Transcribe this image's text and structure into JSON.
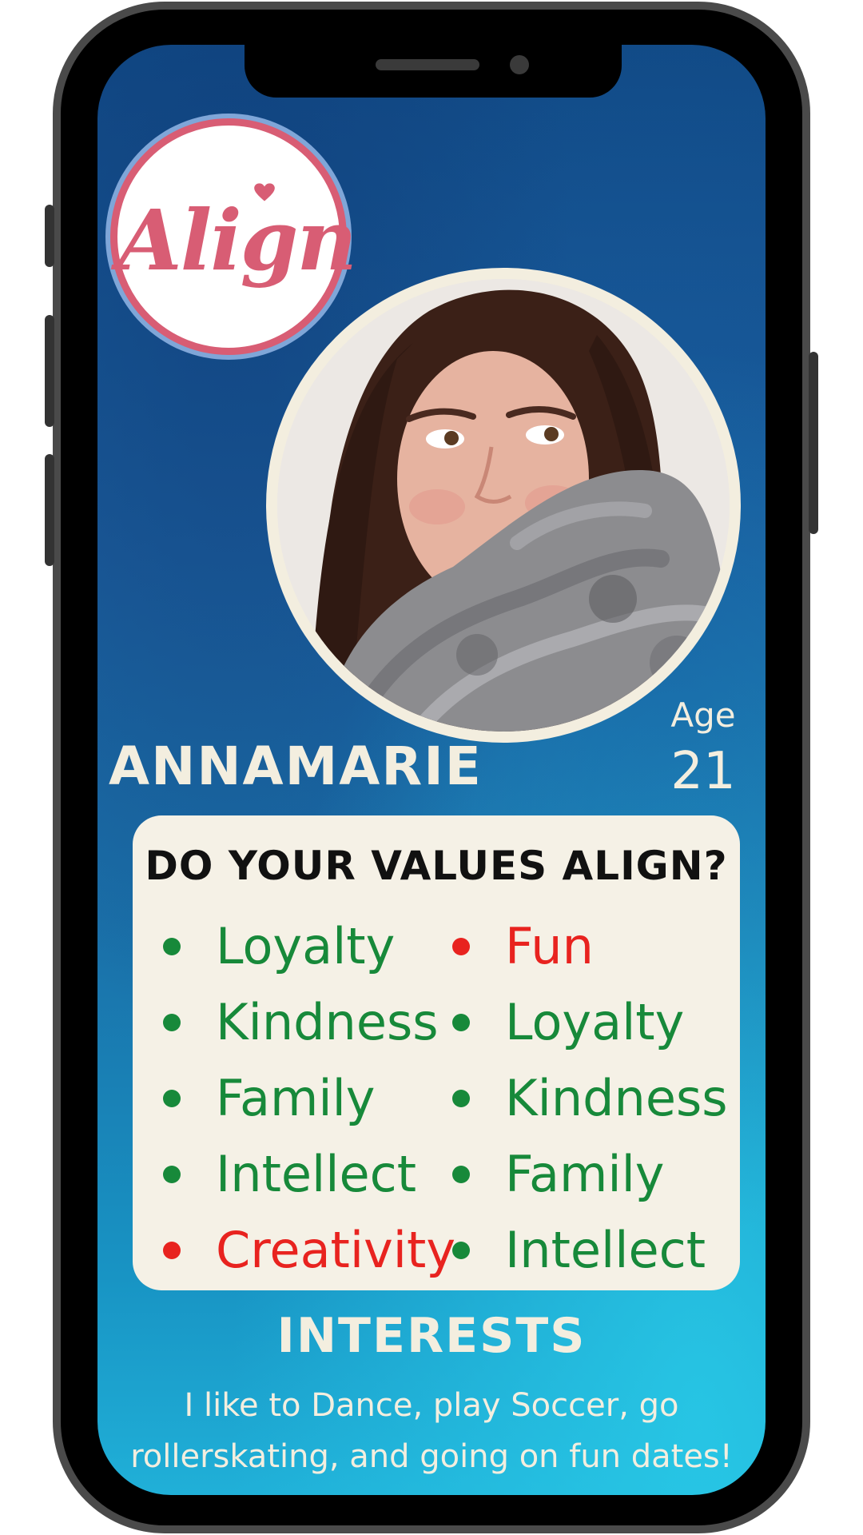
{
  "app": {
    "logo_text": "Align"
  },
  "profile": {
    "name": "ANNAMARIE",
    "age_label": "Age",
    "age_value": "21",
    "photo_icon": "profile-photo"
  },
  "values_card": {
    "title": "DO YOUR VALUES ALIGN?",
    "left_column": [
      {
        "label": "Loyalty",
        "status": "match"
      },
      {
        "label": "Kindness",
        "status": "match"
      },
      {
        "label": "Family",
        "status": "match"
      },
      {
        "label": "Intellect",
        "status": "match"
      },
      {
        "label": "Creativity",
        "status": "mismatch"
      }
    ],
    "right_column": [
      {
        "label": "Fun",
        "status": "mismatch"
      },
      {
        "label": "Loyalty",
        "status": "match"
      },
      {
        "label": "Kindness",
        "status": "match"
      },
      {
        "label": "Family",
        "status": "match"
      },
      {
        "label": "Intellect",
        "status": "match"
      }
    ]
  },
  "interests": {
    "title": "INTERESTS",
    "text": "I like to Dance, play Soccer, go rollerskating, and going on fun dates!"
  },
  "colors": {
    "logo_pink": "#d85d74",
    "logo_ring_blue": "#7fa6d8",
    "match_green": "#17893a",
    "mismatch_red": "#e8231f",
    "cream": "#f3eedf"
  }
}
